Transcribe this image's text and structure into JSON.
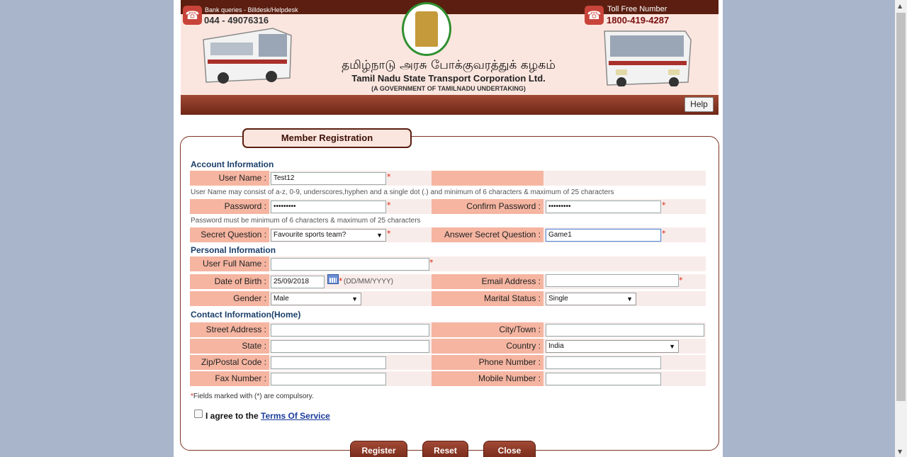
{
  "header": {
    "bank_queries_label": "Bank queries - Billdesk/Helpdesk",
    "bank_queries_phone": "044 - 49076316",
    "toll_free_label": "Toll Free Number",
    "toll_free_number": "1800-419-4287",
    "title_tamil": "தமிழ்நாடு அரசு போக்குவரத்துக் கழகம்",
    "title_english": "Tamil Nadu State Transport Corporation Ltd.",
    "subtitle": "(A GOVERNMENT OF TAMILNADU UNDERTAKING)",
    "phone_icon": "phone-icon",
    "emblem_icon": "tn-govt-emblem",
    "bus_icon": "bus-image"
  },
  "nav": {
    "help_label": "Help"
  },
  "form": {
    "title": "Member Registration",
    "account_section": "Account Information",
    "user_name_label": "User Name :",
    "user_name_value": "Test12",
    "user_name_hint": "User Name may consist of a-z, 0-9, underscores,hyphen and a single dot (.) and minimum of 6 characters & maximum of 25 characters",
    "password_label": "Password :",
    "password_value": "•••••••••",
    "confirm_password_label": "Confirm Password :",
    "confirm_password_value": "•••••••••",
    "password_hint": "Password must be minimum of 6 characters & maximum of 25 characters",
    "secret_question_label": "Secret Question :",
    "secret_question_value": "Favourite sports team?",
    "answer_secret_label": "Answer Secret Question :",
    "answer_secret_value": "Game1",
    "personal_section": "Personal Information",
    "full_name_label": "User Full Name :",
    "full_name_value": "",
    "dob_label": "Date of Birth :",
    "dob_value": "25/09/2018",
    "dob_format": "(DD/MM/YYYY)",
    "email_label": "Email Address :",
    "email_value": "",
    "gender_label": "Gender :",
    "gender_value": "Male",
    "marital_label": "Marital Status :",
    "marital_value": "Single",
    "contact_section": "Contact Information(Home)",
    "street_label": "Street Address :",
    "city_label": "City/Town  :",
    "state_label": "State :",
    "country_label": "Country :",
    "country_value": "India",
    "zip_label": "Zip/Postal Code :",
    "phone_label": "Phone Number :",
    "fax_label": "Fax Number :",
    "mobile_label": "Mobile Number :",
    "required_star": "*",
    "compulsory_text": "Fields marked with (*) are compulsory.",
    "agree_text": "I agree to the",
    "terms_link": "Terms Of Service",
    "register_label": "Register",
    "reset_label": "Reset",
    "close_label": "Close",
    "dropdown_arrow": "▼",
    "calendar_icon": "calendar-icon"
  },
  "colors": {
    "page_bg": "#a9b5cb",
    "brand_dark": "#5b1e10",
    "label_bg": "#f5b5a1",
    "row_bg": "#f8ecea",
    "section_title": "#1b3f6b",
    "required": "#d21"
  }
}
